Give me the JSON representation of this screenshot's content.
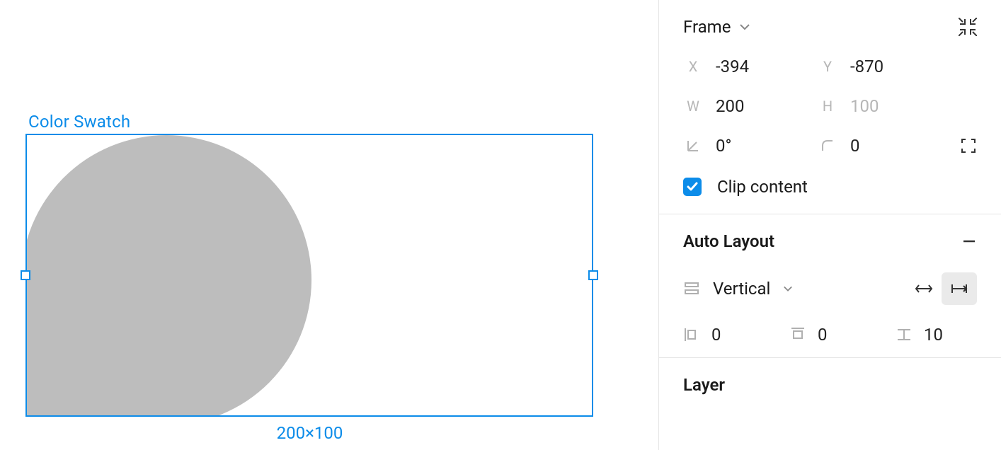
{
  "selection": {
    "label": "Color Swatch",
    "dimensions": "200×100"
  },
  "frame": {
    "title": "Frame",
    "x_label": "X",
    "x": "-394",
    "y_label": "Y",
    "y": "-870",
    "w_label": "W",
    "w": "200",
    "h_label": "H",
    "h": "100",
    "rotation": "0°",
    "radius": "0",
    "clip_content_label": "Clip content",
    "clip_content": true
  },
  "auto_layout": {
    "title": "Auto Layout",
    "direction": "Vertical",
    "padding_h": "0",
    "padding_v": "0",
    "spacing": "10"
  },
  "layer": {
    "title": "Layer"
  }
}
